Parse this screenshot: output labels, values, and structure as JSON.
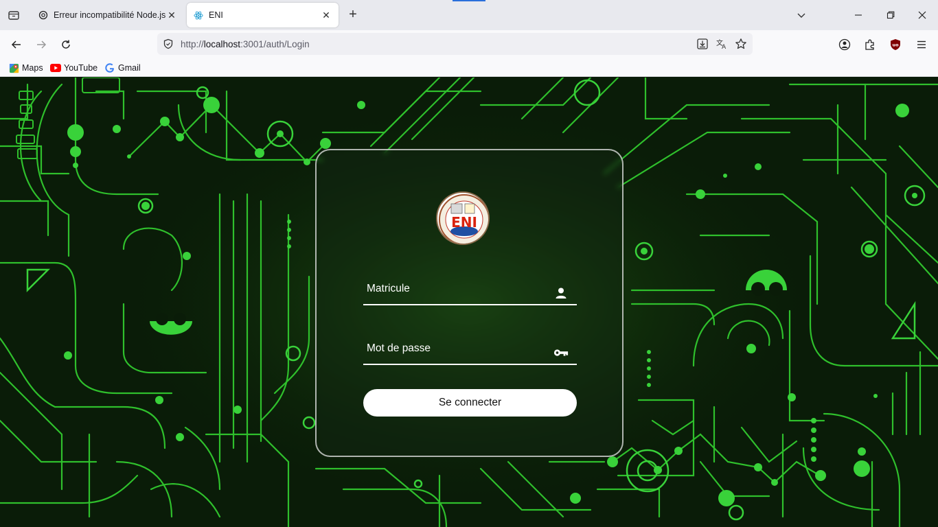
{
  "tabs": [
    {
      "title": "Erreur incompatibilité Node.js",
      "favicon": "chatgpt-icon",
      "active": false
    },
    {
      "title": "ENI",
      "favicon": "react-icon",
      "active": true
    }
  ],
  "tab_close_glyph": "✕",
  "new_tab_glyph": "+",
  "address": {
    "scheme": "http://",
    "host": "localhost",
    "rest": ":3001/auth/Login"
  },
  "bookmarks": [
    {
      "label": "Maps",
      "icon": "google-maps-icon"
    },
    {
      "label": "YouTube",
      "icon": "youtube-icon"
    },
    {
      "label": "Gmail",
      "icon": "google-icon"
    }
  ],
  "login": {
    "logo_text": "ENI",
    "matricule_placeholder": "Matricule",
    "password_placeholder": "Mot de passe",
    "submit_label": "Se connecter"
  },
  "colors": {
    "accent_green": "#39d23a",
    "background_dark": "#0b1f09",
    "card_border": "#e6e6e6",
    "tab_active": "#ffffff",
    "tabbar": "#e8e9ee"
  }
}
